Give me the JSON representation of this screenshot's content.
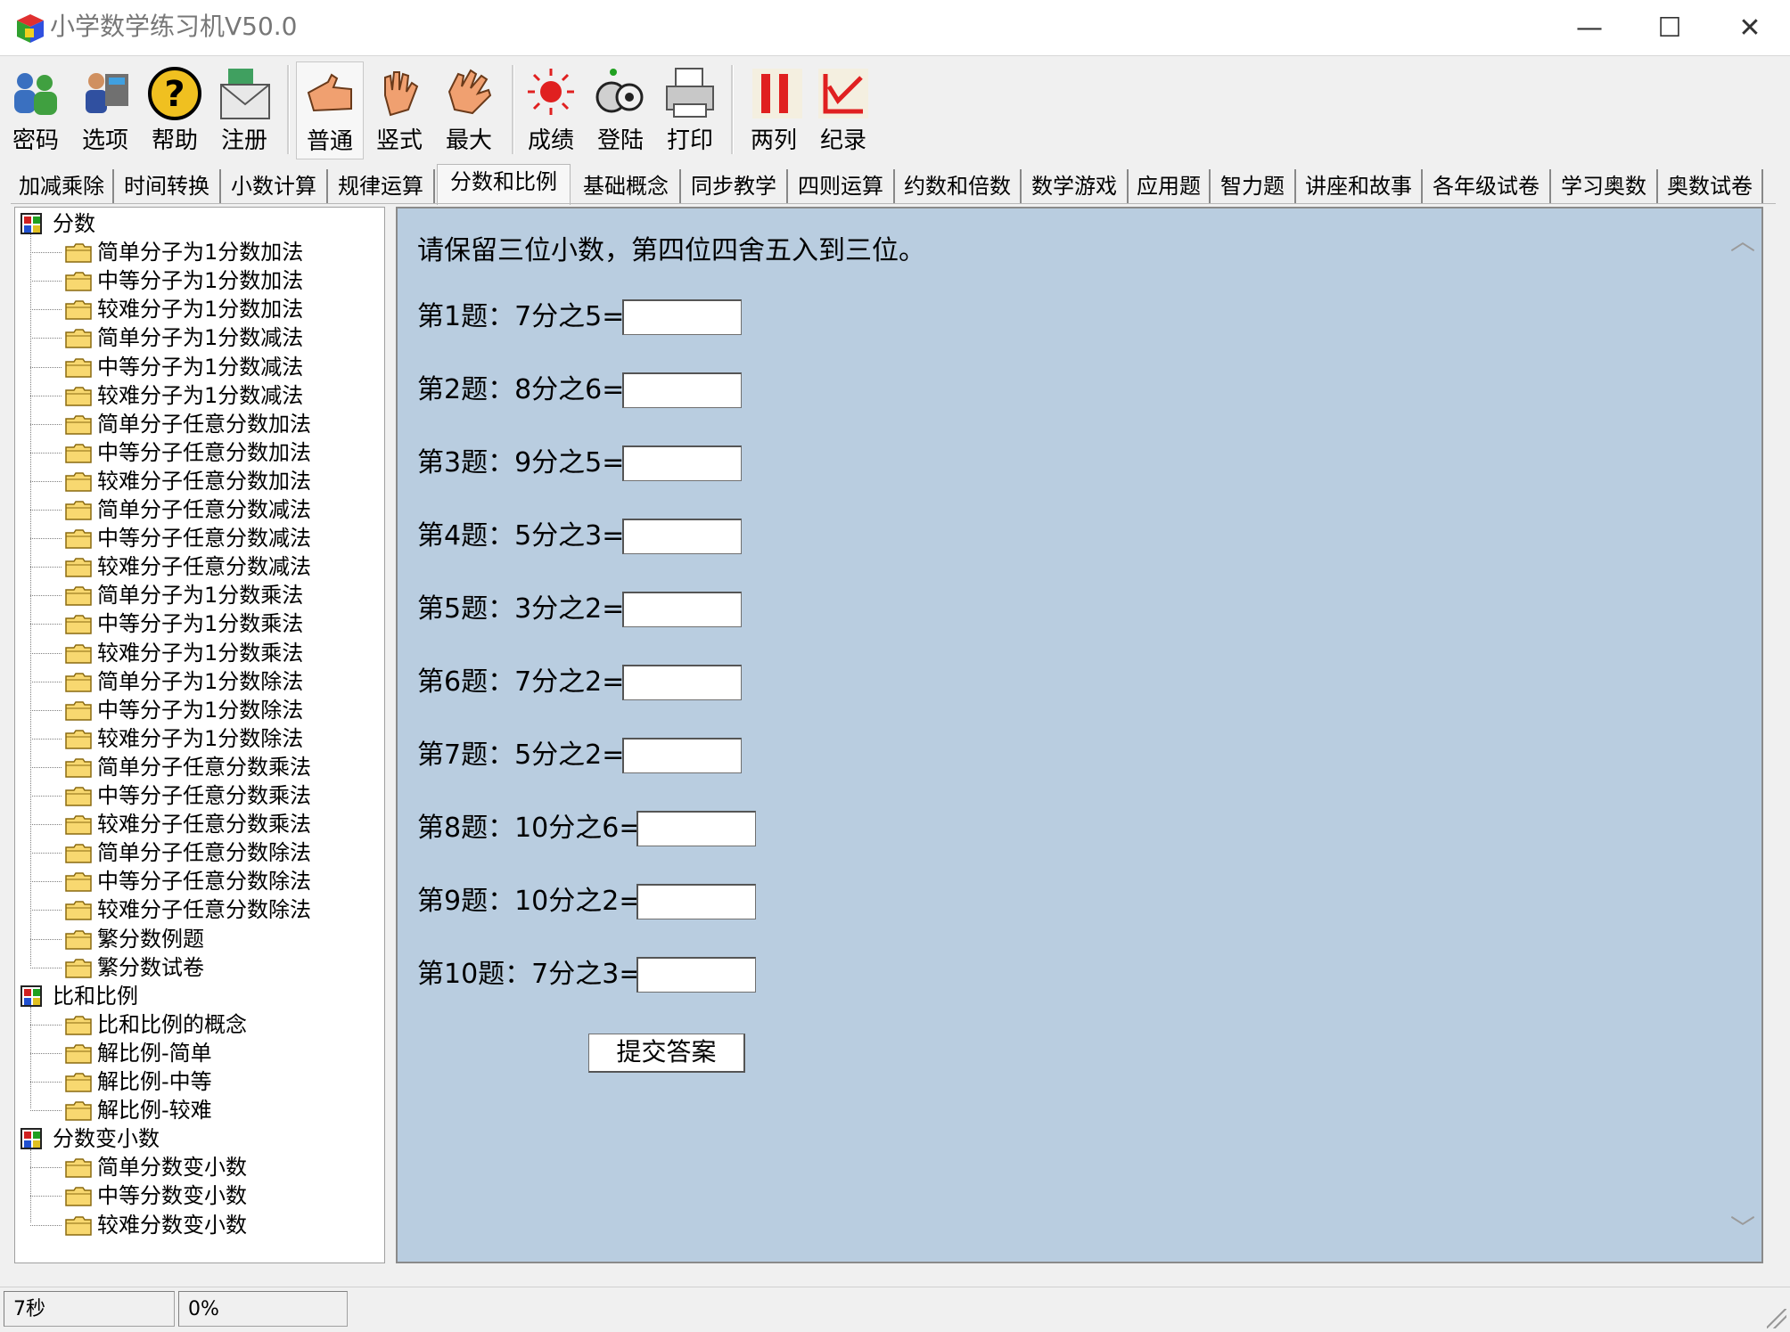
{
  "window": {
    "title": "小学数学练习机V50.0",
    "minimize": "—",
    "maximize": "☐",
    "close": "✕"
  },
  "toolbar": [
    {
      "label": "密码",
      "icon": "users-icon"
    },
    {
      "label": "选项",
      "icon": "options-icon"
    },
    {
      "label": "帮助",
      "icon": "help-icon"
    },
    {
      "label": "注册",
      "icon": "register-mail-icon"
    },
    {
      "label": "普通",
      "icon": "pointing-hand-icon",
      "active": true
    },
    {
      "label": "竖式",
      "icon": "raised-hand-icon"
    },
    {
      "label": "最大",
      "icon": "open-hand-icon"
    },
    {
      "label": "成绩",
      "icon": "score-burst-icon"
    },
    {
      "label": "登陆",
      "icon": "login-icon"
    },
    {
      "label": "打印",
      "icon": "printer-icon"
    },
    {
      "label": "两列",
      "icon": "two-columns-icon"
    },
    {
      "label": "纪录",
      "icon": "record-chart-icon"
    }
  ],
  "tabs": [
    "加减乘除",
    "时间转换",
    "小数计算",
    "规律运算",
    "分数和比例",
    "基础概念",
    "同步教学",
    "四则运算",
    "约数和倍数",
    "数学游戏",
    "应用题",
    "智力题",
    "讲座和故事",
    "各年级试卷",
    "学习奥数",
    "奥数试卷"
  ],
  "active_tab": "分数和比例",
  "tree": [
    {
      "label": "分数",
      "children": [
        "简单分子为1分数加法",
        "中等分子为1分数加法",
        "较难分子为1分数加法",
        "简单分子为1分数减法",
        "中等分子为1分数减法",
        "较难分子为1分数减法",
        "简单分子任意分数加法",
        "中等分子任意分数加法",
        "较难分子任意分数加法",
        "简单分子任意分数减法",
        "中等分子任意分数减法",
        "较难分子任意分数减法",
        "简单分子为1分数乘法",
        "中等分子为1分数乘法",
        "较难分子为1分数乘法",
        "简单分子为1分数除法",
        "中等分子为1分数除法",
        "较难分子为1分数除法",
        "简单分子任意分数乘法",
        "中等分子任意分数乘法",
        "较难分子任意分数乘法",
        "简单分子任意分数除法",
        "中等分子任意分数除法",
        "较难分子任意分数除法",
        "繁分数例题",
        "繁分数试卷"
      ]
    },
    {
      "label": "比和比例",
      "children": [
        "比和比例的概念",
        "解比例-简单",
        "解比例-中等",
        "解比例-较难"
      ]
    },
    {
      "label": "分数变小数",
      "children": [
        "简单分数变小数",
        "中等分数变小数",
        "较难分数变小数"
      ]
    }
  ],
  "main": {
    "instruction": "请保留三位小数，第四位四舍五入到三位。",
    "questions": [
      {
        "label": "第1题：7分之5=",
        "value": ""
      },
      {
        "label": "第2题：8分之6=",
        "value": ""
      },
      {
        "label": "第3题：9分之5=",
        "value": ""
      },
      {
        "label": "第4题：5分之3=",
        "value": ""
      },
      {
        "label": "第5题：3分之2=",
        "value": ""
      },
      {
        "label": "第6题：7分之2=",
        "value": ""
      },
      {
        "label": "第7题：5分之2=",
        "value": ""
      },
      {
        "label": "第8题：10分之6=",
        "value": ""
      },
      {
        "label": "第9题：10分之2=",
        "value": ""
      },
      {
        "label": "第10题：7分之3=",
        "value": ""
      }
    ],
    "submit_label": "提交答案"
  },
  "status": {
    "time": "7秒",
    "progress": "0%"
  },
  "colors": {
    "content_bg": "#b9cde0"
  }
}
